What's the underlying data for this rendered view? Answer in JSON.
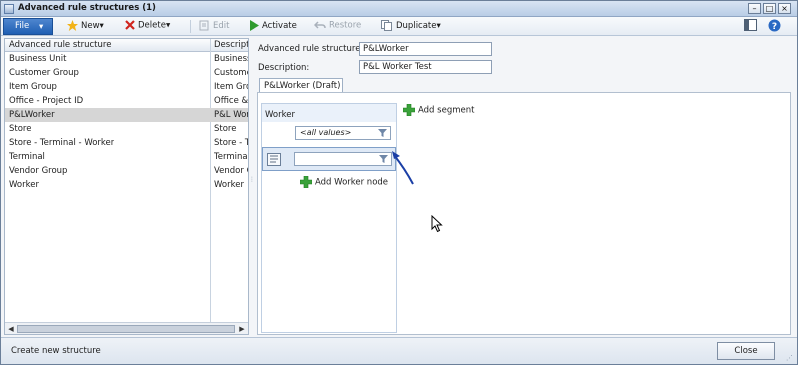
{
  "window": {
    "title": "Advanced rule structures (1)"
  },
  "toolbar": {
    "file": "File",
    "new": "New",
    "delete": "Delete",
    "edit": "Edit",
    "activate": "Activate",
    "restore": "Restore",
    "duplicate": "Duplicate"
  },
  "list": {
    "columns": [
      "Advanced rule structure",
      "Descripti"
    ],
    "rows": [
      [
        "Business Unit",
        "Business"
      ],
      [
        "Customer Group",
        "Custome"
      ],
      [
        "Item Group",
        "Item Grou"
      ],
      [
        "Office - Project ID",
        "Office &"
      ],
      [
        "P&LWorker",
        "P&L Wor"
      ],
      [
        "Store",
        "Store"
      ],
      [
        "Store - Terminal - Worker",
        "Store - T"
      ],
      [
        "Terminal",
        "Terminal"
      ],
      [
        "Vendor Group",
        "Vendor G"
      ],
      [
        "Worker",
        "Worker"
      ]
    ],
    "selected_index": 4
  },
  "detail": {
    "structure_label": "Advanced rule structure:",
    "structure_value": "P&LWorker",
    "description_label": "Description:",
    "description_value": "P&L Worker Test",
    "tab": "P&LWorker (Draft)",
    "add_segment": "Add segment",
    "segment_title": "Worker",
    "all_values": "<all values>",
    "add_node": "Add Worker node"
  },
  "status": {
    "text": "Create new structure",
    "close": "Close"
  }
}
